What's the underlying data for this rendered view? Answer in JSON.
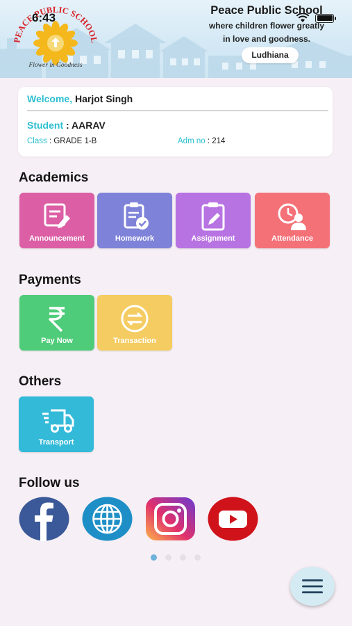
{
  "status_bar": {
    "time": "6:43"
  },
  "header": {
    "logo_text_top": "PEACE PUBLIC SCHOOL",
    "logo_text_bottom": "Flower in Goodness",
    "school_name": "Peace Public School",
    "tagline_line1": "where children flower greatly",
    "tagline_line2": "in love and goodness.",
    "city": "Ludhiana"
  },
  "profile": {
    "welcome_label": "Welcome,",
    "user_name": "Harjot Singh",
    "student_label": "Student",
    "student_sep": " : ",
    "student_name": "AARAV",
    "class_label": "Class",
    "class_sep": " : ",
    "class_value": "GRADE 1-B",
    "adm_label": "Adm no",
    "adm_sep": " : ",
    "adm_value": "214"
  },
  "sections": {
    "academics": {
      "title": "Academics",
      "items": [
        {
          "label": "Announcement",
          "icon": "edit-note-icon",
          "color": "#dc5fa6"
        },
        {
          "label": "Homework",
          "icon": "clipboard-check-icon",
          "color": "#7e82d8"
        },
        {
          "label": "Assignment",
          "icon": "clipboard-pencil-icon",
          "color": "#b873e3"
        },
        {
          "label": "Attendance",
          "icon": "clock-user-icon",
          "color": "#f47178"
        }
      ]
    },
    "payments": {
      "title": "Payments",
      "items": [
        {
          "label": "Pay Now",
          "icon": "rupee-icon",
          "color": "#4fcc79"
        },
        {
          "label": "Transaction",
          "icon": "exchange-icon",
          "color": "#f4cc62"
        }
      ]
    },
    "others": {
      "title": "Others",
      "items": [
        {
          "label": "Transport",
          "icon": "delivery-truck-icon",
          "color": "#34bad9"
        }
      ]
    },
    "follow": {
      "title": "Follow us",
      "items": [
        {
          "icon": "facebook-icon",
          "color": "#3b5998"
        },
        {
          "icon": "globe-icon",
          "color": "#1e8fc6"
        },
        {
          "icon": "instagram-icon",
          "color": "#d6249f"
        },
        {
          "icon": "youtube-icon",
          "color": "#d0121b"
        }
      ]
    }
  },
  "pager": {
    "count": 4,
    "active": 0
  },
  "colors": {
    "accent": "#2bbfd0",
    "background": "#f6eff5"
  }
}
